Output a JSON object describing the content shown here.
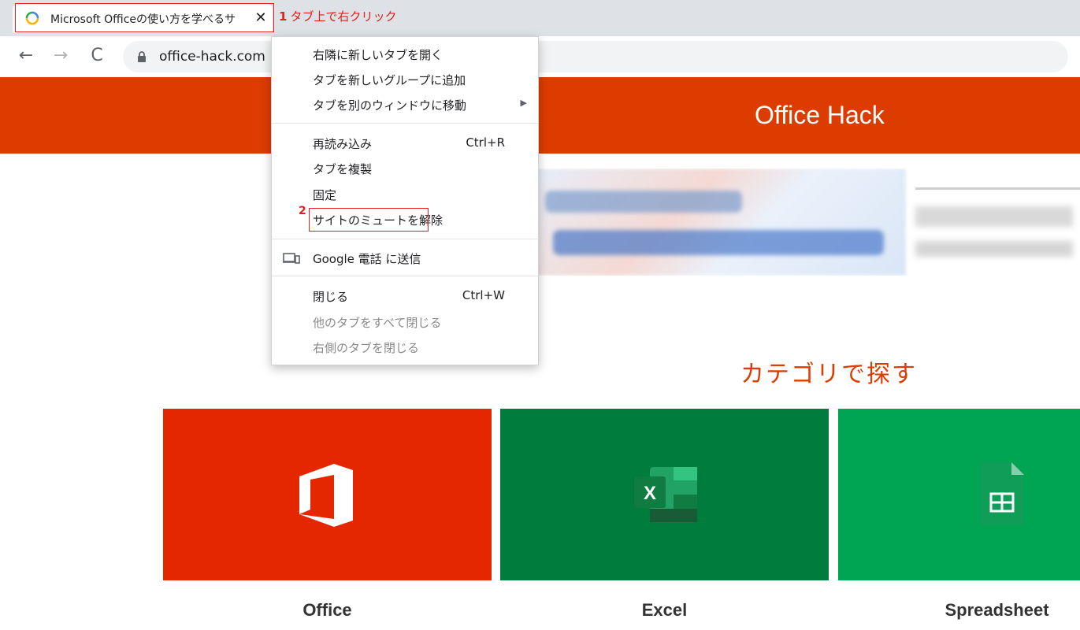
{
  "browser": {
    "tab": {
      "title": "Microsoft Officeの使い方を学べるサ",
      "close_glyph": "✕"
    },
    "toolbar": {
      "back_glyph": "←",
      "forward_glyph": "→",
      "reload_glyph": "C",
      "url": "office-hack.com"
    }
  },
  "annotations": {
    "step1_number": "1",
    "step1_text": "タブ上で右クリック",
    "step2_number": "2",
    "color": "#e0201a"
  },
  "site": {
    "title": "Office Hack",
    "brand_color": "#dc3c00",
    "category_heading": "カテゴリで探す",
    "tiles": [
      {
        "label": "Office",
        "color": "#e52700",
        "icon": "office-logo-icon"
      },
      {
        "label": "Excel",
        "color": "#007d3c",
        "icon": "excel-logo-icon"
      },
      {
        "label": "Spreadsheet",
        "color": "#00a554",
        "icon": "sheets-logo-icon"
      }
    ]
  },
  "context_menu": {
    "items": [
      {
        "label": "右隣に新しいタブを開く"
      },
      {
        "label": "タブを新しいグループに追加"
      },
      {
        "label": "タブを別のウィンドウに移動",
        "submenu": true
      },
      {
        "label": "再読み込み",
        "shortcut": "Ctrl+R"
      },
      {
        "label": "タブを複製"
      },
      {
        "label": "固定"
      },
      {
        "label": "サイトのミュートを解除",
        "highlighted": true
      },
      {
        "label": "Google 電話 に送信",
        "icon": "device-icon"
      },
      {
        "label": "閉じる",
        "shortcut": "Ctrl+W"
      },
      {
        "label": "他のタブをすべて閉じる",
        "disabled": true
      },
      {
        "label": "右側のタブを閉じる",
        "disabled": true
      }
    ]
  }
}
